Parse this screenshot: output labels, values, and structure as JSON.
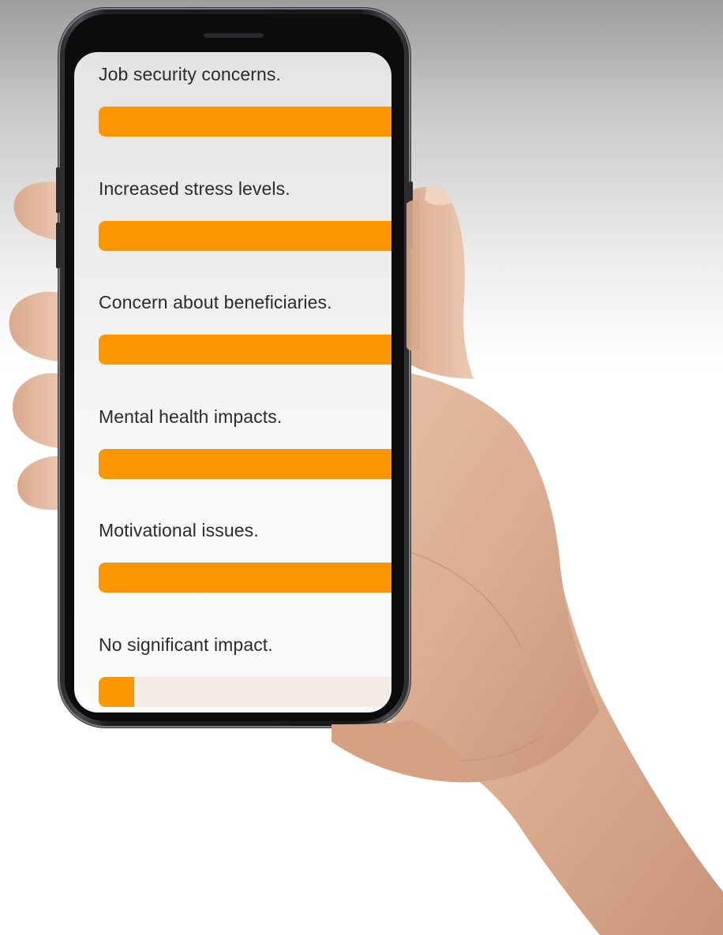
{
  "poll": {
    "accent_color": "#fb9600",
    "track_color": "#f3ebe2",
    "items": [
      {
        "label": "Job security concerns.",
        "fill_fraction": 1.0
      },
      {
        "label": "Increased stress levels.",
        "fill_fraction": 1.0
      },
      {
        "label": "Concern about beneficiaries.",
        "fill_fraction": 1.0
      },
      {
        "label": "Mental health impacts.",
        "fill_fraction": 1.0
      },
      {
        "label": "Motivational issues.",
        "fill_fraction": 1.0
      },
      {
        "label": "No significant impact.",
        "fill_fraction": 0.12
      }
    ]
  }
}
